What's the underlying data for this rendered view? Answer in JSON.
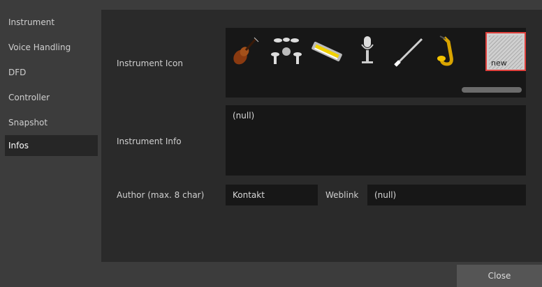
{
  "sidebar": {
    "items": [
      {
        "label": "Instrument",
        "active": false
      },
      {
        "label": "Voice Handling",
        "active": false
      },
      {
        "label": "DFD",
        "active": false
      },
      {
        "label": "Controller",
        "active": false
      },
      {
        "label": "Snapshot",
        "active": false
      },
      {
        "label": "Infos",
        "active": true
      }
    ]
  },
  "main": {
    "instrument_icon_label": "Instrument Icon",
    "icons": [
      {
        "name": "violin-icon"
      },
      {
        "name": "drumkit-icon"
      },
      {
        "name": "keyboard-icon"
      },
      {
        "name": "microphone-icon"
      },
      {
        "name": "clarinet-icon"
      },
      {
        "name": "saxophone-icon"
      },
      {
        "name": "new-icon",
        "label": "new",
        "selected": true
      }
    ],
    "instrument_info_label": "Instrument Info",
    "instrument_info_value": "(null)",
    "author_label": "Author (max. 8 char)",
    "author_value": "Kontakt",
    "weblink_label": "Weblink",
    "weblink_value": "(null)"
  },
  "footer": {
    "close_label": "Close"
  },
  "colors": {
    "background": "#3c3c3c",
    "panel": "#2a2a2a",
    "field": "#171717",
    "selection_border": "#e0403c",
    "active_sidebar": "#262626"
  }
}
